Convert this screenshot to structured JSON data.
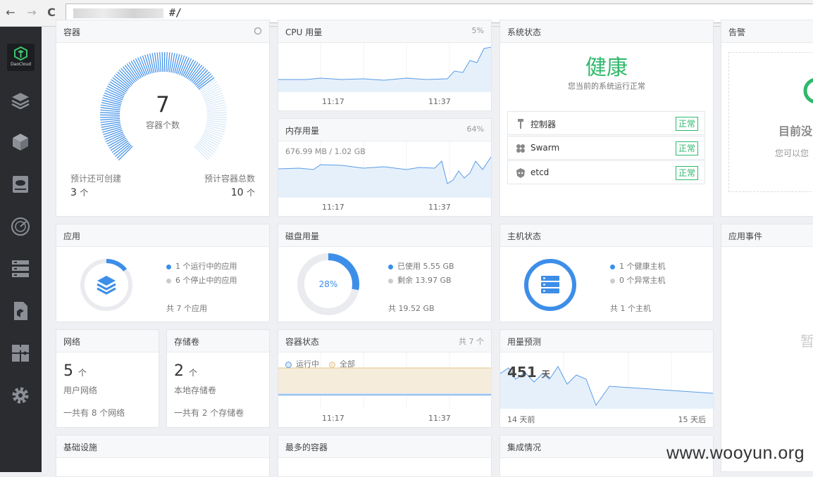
{
  "browser": {
    "back": "←",
    "forward": "→",
    "reload": "C",
    "url_suffix": "#/"
  },
  "sidebar": {
    "logo_text": "DaoCloud"
  },
  "containers": {
    "title": "容器",
    "count": "7",
    "count_label": "容器个数",
    "creatable_label": "预计还可创建",
    "creatable_value": "3",
    "total_label": "预计容器总数",
    "total_value": "10",
    "unit": "个",
    "gauge_fraction": 0.7
  },
  "cpu": {
    "title": "CPU 用量",
    "percent": "5%",
    "ticks": [
      "11:17",
      "11:37"
    ]
  },
  "memory": {
    "title": "内存用量",
    "percent": "64%",
    "usage": "676.99 MB / 1.02 GB",
    "ticks": [
      "11:17",
      "11:37"
    ]
  },
  "system": {
    "title": "系统状态",
    "status": "健康",
    "subtitle": "您当前的系统运行正常",
    "components": [
      {
        "name": "控制器",
        "status": "正常"
      },
      {
        "name": "Swarm",
        "status": "正常"
      },
      {
        "name": "etcd",
        "status": "正常"
      }
    ]
  },
  "alerts": {
    "title": "告警",
    "empty_title": "目前没",
    "empty_sub": "您可以您"
  },
  "apps": {
    "title": "应用",
    "running": "1 个运行中的应用",
    "stopped": "6 个停止中的应用",
    "total": "共 7 个应用",
    "running_fraction": 0.143
  },
  "disk": {
    "title": "磁盘用量",
    "percent": "28%",
    "used": "已使用 5.55 GB",
    "free": "剩余 13.97 GB",
    "total": "共 19.52 GB",
    "used_fraction": 0.28
  },
  "hosts": {
    "title": "主机状态",
    "healthy": "1 个健康主机",
    "abnormal": "0 个异常主机",
    "total": "共 1 个主机"
  },
  "app_events": {
    "title": "应用事件",
    "empty": "暂"
  },
  "network": {
    "title": "网络",
    "count": "5",
    "unit": "个",
    "label": "用户网络",
    "footer": "一共有 8 个网络"
  },
  "volumes": {
    "title": "存储卷",
    "count": "2",
    "unit": "个",
    "label": "本地存储卷",
    "footer": "一共有 2 个存储卷"
  },
  "container_status": {
    "title": "容器状态",
    "total": "共 7 个",
    "legend_running": "运行中",
    "legend_all": "全部",
    "ticks": [
      "11:17",
      "11:37"
    ]
  },
  "forecast": {
    "title": "用量预测",
    "value": "451",
    "unit": "天",
    "tick_left": "14 天前",
    "tick_right": "15 天后"
  },
  "infrastructure": {
    "title": "基础设施"
  },
  "top_containers": {
    "title": "最多的容器"
  },
  "integrations": {
    "title": "集成情况"
  },
  "watermark": "www.wooyun.org",
  "colors": {
    "accent": "#3d8ee8",
    "healthy": "#2fb96b",
    "sidebar": "#2a2c30",
    "logo_green": "#3ec46d"
  }
}
